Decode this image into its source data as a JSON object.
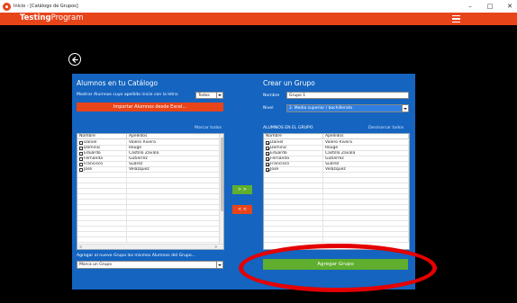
{
  "window": {
    "title": "Inicio - [Catálogo de Grupos]",
    "minimize": "–",
    "maximize": "□",
    "close": "✕"
  },
  "header": {
    "logo_bold": "Testing",
    "logo_thin": "Program"
  },
  "left": {
    "heading": "Alumnos en tu Catálogo",
    "filter_label": "Mostrar Alumnos cuyo apellido inicie con la letra:",
    "filter_value": "Todos",
    "import_button": "Importar Alumnos desde Excel...",
    "mark_all": "Marcar todos",
    "columns": [
      "Nombre",
      "Apellidos"
    ],
    "rows": [
      {
        "name": "Daniel",
        "surname": "Valero Rivera",
        "checked": false
      },
      {
        "name": "Dominic",
        "surname": "Rouge",
        "checked": false
      },
      {
        "name": "Eduardo",
        "surname": "Castillo Zavala",
        "checked": false
      },
      {
        "name": "Fernanda",
        "surname": "Gutierrez",
        "checked": false
      },
      {
        "name": "Francisco",
        "surname": "Suárez",
        "checked": false
      },
      {
        "name": "José",
        "surname": "Velázquez",
        "checked": false
      }
    ],
    "add_group_label": "Agregar al nuevo Grupo los mismos Alumnos del Grupo...",
    "group_select_value": "Marca un Grupo"
  },
  "transfer": {
    "add_label": "> >",
    "remove_label": "< <"
  },
  "right": {
    "heading": "Crear un Grupo",
    "name_label": "Nombre",
    "name_value": "Grupo 1",
    "level_label": "Nivel",
    "level_value": "2. Media superior / bachillerato",
    "students_label": "ALUMNOS EN EL GRUPO",
    "unmark_all": "Desmarcar todos",
    "columns": [
      "Nombre",
      "Apellidos"
    ],
    "rows": [
      {
        "name": "Daniel",
        "surname": "Valero Rivera",
        "checked": true
      },
      {
        "name": "Dominic",
        "surname": "Rouge",
        "checked": true
      },
      {
        "name": "Eduardo",
        "surname": "Castillo Zavala",
        "checked": true
      },
      {
        "name": "Fernanda",
        "surname": "Gutierrez",
        "checked": true
      },
      {
        "name": "Francisco",
        "surname": "Suárez",
        "checked": true
      },
      {
        "name": "José",
        "surname": "Velázquez",
        "checked": true
      }
    ],
    "add_group_button": "Agregar Grupo"
  },
  "colors": {
    "accent": "#e8441a",
    "panel": "#1464c0",
    "success": "#5fae2e",
    "annotation": "#e50000"
  }
}
